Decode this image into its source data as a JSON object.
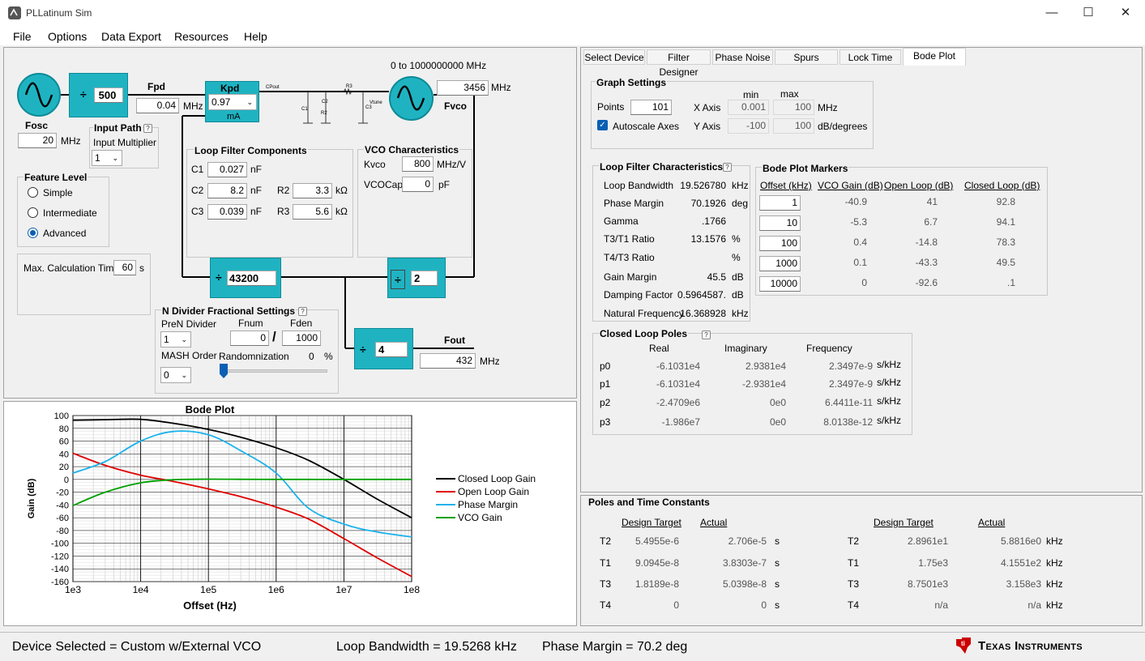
{
  "app": {
    "title": "PLLatinum Sim"
  },
  "menu": [
    "File",
    "Options",
    "Data Export",
    "Resources",
    "Help"
  ],
  "diagram": {
    "r_divider": "500",
    "fpd_label": "Fpd",
    "fpd_value": "0.04",
    "fpd_unit": "MHz",
    "kpd_label": "Kpd",
    "kpd_value": "0.97",
    "kpd_unit": "mA",
    "cpout_label": "CPout",
    "vtune_label": "Vtune",
    "r3_label": "R3",
    "c1_label": "C1",
    "c2_label": "C2",
    "r2_label": "R2",
    "c3_label": "C3",
    "vco_range": "0 to 1000000000 MHz",
    "fvco_value": "3456",
    "fvco_unit": "MHz",
    "fvco_label": "Fvco",
    "fosc_label": "Fosc",
    "fosc_value": "20",
    "fosc_unit": "MHz",
    "n_divider": "43200",
    "pre_divider": "2",
    "out_divider": "4",
    "fout_label": "Fout",
    "fout_value": "432",
    "fout_unit": "MHz"
  },
  "input_path": {
    "title": "Input Path",
    "multiplier_label": "Input Multiplier",
    "multiplier_value": "1"
  },
  "feature_level": {
    "title": "Feature Level",
    "options": [
      "Simple",
      "Intermediate",
      "Advanced"
    ],
    "selected": "Advanced"
  },
  "calc_time": {
    "label": "Max. Calculation Time",
    "value": "60",
    "unit": "s"
  },
  "loop_filter": {
    "title": "Loop Filter Components",
    "c1": {
      "label": "C1",
      "value": "0.027",
      "unit": "nF"
    },
    "c2": {
      "label": "C2",
      "value": "8.2",
      "unit": "nF"
    },
    "c3": {
      "label": "C3",
      "value": "0.039",
      "unit": "nF"
    },
    "r2": {
      "label": "R2",
      "value": "3.3",
      "unit": "kΩ"
    },
    "r3": {
      "label": "R3",
      "value": "5.6",
      "unit": "kΩ"
    }
  },
  "vco_char": {
    "title": "VCO Characteristics",
    "kvco_label": "Kvco",
    "kvco_value": "800",
    "kvco_unit": "MHz/V",
    "vcocap_label": "VCOCap",
    "vcocap_value": "0",
    "vcocap_unit": "pF"
  },
  "n_frac": {
    "title": "N Divider Fractional Settings",
    "pren_label": "PreN Divider",
    "pren_value": "1",
    "fnum_label": "Fnum",
    "fnum_value": "0",
    "slash": "/",
    "fden_label": "Fden",
    "fden_value": "1000",
    "mash_label": "MASH Order",
    "mash_value": "0",
    "rand_label": "Randomnization",
    "rand_value": "0",
    "rand_unit": "%"
  },
  "tabs": [
    "Select Device",
    "Filter Designer",
    "Phase Noise",
    "Spurs",
    "Lock Time",
    "Bode Plot"
  ],
  "active_tab": "Bode Plot",
  "graph_settings": {
    "title": "Graph Settings",
    "min_label": "min",
    "max_label": "max",
    "points_label": "Points",
    "points_value": "101",
    "xaxis_label": "X Axis",
    "xaxis_min": "0.001",
    "xaxis_max": "100",
    "xaxis_unit": "MHz",
    "autoscale_label": "Autoscale Axes",
    "autoscale_checked": true,
    "yaxis_label": "Y Axis",
    "yaxis_min": "-100",
    "yaxis_max": "100",
    "yaxis_unit": "dB/degrees"
  },
  "lf_char": {
    "title": "Loop Filter Characteristics",
    "rows": [
      {
        "label": "Loop Bandwidth",
        "value": "19.526780",
        "unit": "kHz"
      },
      {
        "label": "Phase Margin",
        "value": "70.1926",
        "unit": "deg"
      },
      {
        "label": "Gamma",
        "value": ".1766",
        "unit": ""
      },
      {
        "label": "T3/T1 Ratio",
        "value": "13.1576",
        "unit": "%"
      },
      {
        "label": "T4/T3 Ratio",
        "value": "",
        "unit": "%"
      },
      {
        "label": "Gain Margin",
        "value": "45.5",
        "unit": "dB"
      },
      {
        "label": "Damping Factor",
        "value": "0.5964587.",
        "unit": "dB"
      },
      {
        "label": "Natural Frequency",
        "value": "16.368928",
        "unit": "kHz"
      }
    ]
  },
  "markers": {
    "title": "Bode Plot Markers",
    "headers": [
      "Offset (kHz)",
      "VCO Gain (dB)",
      "Open Loop (dB)",
      "Closed Loop (dB)"
    ],
    "rows": [
      [
        "1",
        "-40.9",
        "41",
        "92.8"
      ],
      [
        "10",
        "-5.3",
        "6.7",
        "94.1"
      ],
      [
        "100",
        "0.4",
        "-14.8",
        "78.3"
      ],
      [
        "1000",
        "0.1",
        "-43.3",
        "49.5"
      ],
      [
        "10000",
        "0",
        "-92.6",
        ".1"
      ]
    ]
  },
  "poles": {
    "title": "Closed Loop Poles",
    "headers": [
      "Real",
      "Imaginary",
      "Frequency"
    ],
    "rows": [
      {
        "name": "p0",
        "real": "-6.1031e4",
        "imag": "2.9381e4",
        "freq": "2.3497e-9",
        "unit": "s/kHz"
      },
      {
        "name": "p1",
        "real": "-6.1031e4",
        "imag": "-2.9381e4",
        "freq": "2.3497e-9",
        "unit": "s/kHz"
      },
      {
        "name": "p2",
        "real": "-2.4709e6",
        "imag": "0e0",
        "freq": "6.4411e-11",
        "unit": "s/kHz"
      },
      {
        "name": "p3",
        "real": "-1.986e7",
        "imag": "0e0",
        "freq": "8.0138e-12",
        "unit": "s/kHz"
      }
    ]
  },
  "time_constants": {
    "title": "Poles and Time Constants",
    "headers": [
      "Design Target",
      "Actual"
    ],
    "left": [
      {
        "name": "T2",
        "target": "5.4955e-6",
        "actual": "2.706e-5",
        "unit": "s"
      },
      {
        "name": "T1",
        "target": "9.0945e-8",
        "actual": "3.8303e-7",
        "unit": "s"
      },
      {
        "name": "T3",
        "target": "1.8189e-8",
        "actual": "5.0398e-8",
        "unit": "s"
      },
      {
        "name": "T4",
        "target": "0",
        "actual": "0",
        "unit": "s"
      }
    ],
    "right": [
      {
        "name": "T2",
        "target": "2.8961e1",
        "actual": "5.8816e0",
        "unit": "kHz"
      },
      {
        "name": "T1",
        "target": "1.75e3",
        "actual": "4.1551e2",
        "unit": "kHz"
      },
      {
        "name": "T3",
        "target": "8.7501e3",
        "actual": "3.158e3",
        "unit": "kHz"
      },
      {
        "name": "T4",
        "target": "n/a",
        "actual": "n/a",
        "unit": "kHz"
      }
    ]
  },
  "status": {
    "device": "Device Selected = Custom w/External VCO",
    "bandwidth": "Loop Bandwidth = 19.5268 kHz",
    "phase_margin": "Phase Margin = 70.2 deg",
    "logo": "Texas Instruments"
  },
  "chart_data": {
    "type": "line",
    "title": "Bode Plot",
    "xlabel": "Offset (Hz)",
    "ylabel": "Gain (dB)",
    "xscale": "log",
    "xlim": [
      1000,
      100000000
    ],
    "ylim": [
      -160,
      100
    ],
    "xticks": [
      "1e3",
      "1e4",
      "1e5",
      "1e6",
      "1e7",
      "1e8"
    ],
    "yticks": [
      100,
      80,
      60,
      40,
      20,
      0,
      -20,
      -40,
      -60,
      -80,
      -100,
      -120,
      -140,
      -160
    ],
    "grid": true,
    "legend": "right",
    "x": [
      1000,
      3000,
      10000,
      30000,
      100000,
      300000,
      1000000,
      3000000,
      10000000,
      30000000,
      100000000
    ],
    "series": [
      {
        "name": "Closed Loop Gain",
        "color": "#000000",
        "values": [
          92.8,
          93.5,
          94.1,
          88,
          78.3,
          66,
          49.5,
          30,
          0.1,
          -30,
          -60
        ]
      },
      {
        "name": "Open Loop Gain",
        "color": "#e00000",
        "values": [
          41,
          22,
          6.7,
          -3,
          -14.8,
          -27,
          -43.3,
          -62,
          -92.6,
          -122,
          -152
        ]
      },
      {
        "name": "Phase Margin",
        "color": "#1ab2ea",
        "values": [
          10,
          28,
          60,
          75,
          70,
          45,
          10,
          -45,
          -70,
          -82,
          -90
        ]
      },
      {
        "name": "VCO Gain",
        "color": "#00a000",
        "values": [
          -40.9,
          -20,
          -5.3,
          -0.5,
          0.4,
          0.2,
          0.1,
          0,
          0,
          0,
          0
        ]
      }
    ]
  }
}
